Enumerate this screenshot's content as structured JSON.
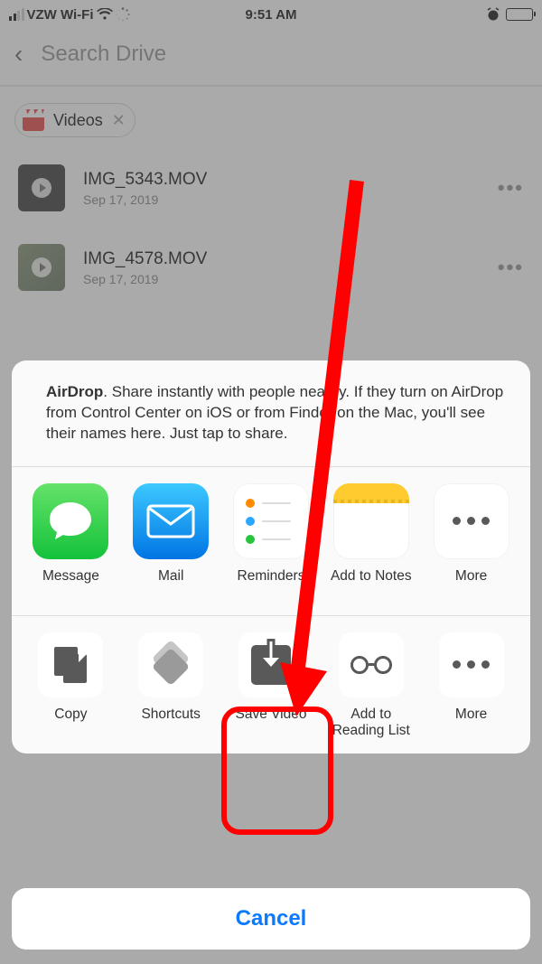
{
  "statusbar": {
    "carrier": "VZW Wi-Fi",
    "time": "9:51 AM"
  },
  "header": {
    "search_placeholder": "Search Drive"
  },
  "filter": {
    "chip_label": "Videos"
  },
  "files": [
    {
      "name": "IMG_5343.MOV",
      "date": "Sep 17, 2019"
    },
    {
      "name": "IMG_4578.MOV",
      "date": "Sep 17, 2019"
    }
  ],
  "sheet": {
    "airdrop_bold": "AirDrop",
    "airdrop_text": ". Share instantly with people nearby. If they turn on AirDrop from Control Center on iOS or from Finder on the Mac, you'll see their names here. Just tap to share.",
    "apps": {
      "message": "Message",
      "mail": "Mail",
      "reminders": "Reminders",
      "notes": "Add to Notes",
      "more": "More"
    },
    "actions": {
      "copy": "Copy",
      "shortcuts": "Shortcuts",
      "save": "Save Video",
      "reading": "Add to Reading List",
      "more": "More"
    },
    "cancel": "Cancel"
  }
}
